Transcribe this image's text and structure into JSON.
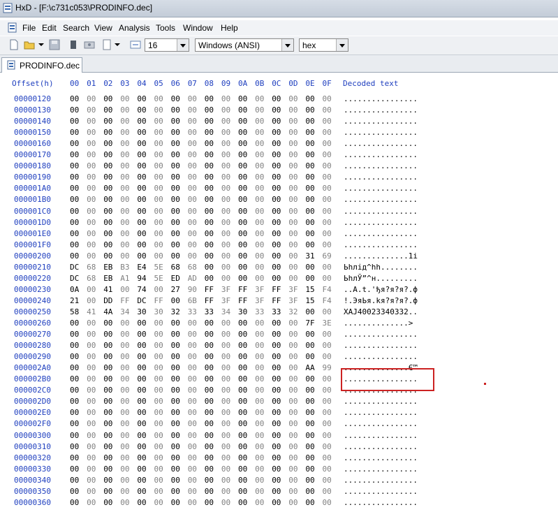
{
  "window": {
    "title": "HxD - [F:\\c731c053\\PRODINFO.dec]"
  },
  "menu": [
    "File",
    "Edit",
    "Search",
    "View",
    "Analysis",
    "Tools",
    "Window",
    "Help"
  ],
  "toolbar": {
    "bytes_per_row": "16",
    "charset": "Windows (ANSI)",
    "offset_base": "hex"
  },
  "tab": {
    "label": "PRODINFO.dec"
  },
  "header": {
    "offset": "Offset(h)",
    "columns": [
      "00",
      "01",
      "02",
      "03",
      "04",
      "05",
      "06",
      "07",
      "08",
      "09",
      "0A",
      "0B",
      "0C",
      "0D",
      "0E",
      "0F"
    ],
    "decoded": "Decoded text"
  },
  "rows": [
    {
      "offset": "00000120",
      "bytes": [
        "00",
        "00",
        "00",
        "00",
        "00",
        "00",
        "00",
        "00",
        "00",
        "00",
        "00",
        "00",
        "00",
        "00",
        "00",
        "00"
      ],
      "text": "................"
    },
    {
      "offset": "00000130",
      "bytes": [
        "00",
        "00",
        "00",
        "00",
        "00",
        "00",
        "00",
        "00",
        "00",
        "00",
        "00",
        "00",
        "00",
        "00",
        "00",
        "00"
      ],
      "text": "................"
    },
    {
      "offset": "00000140",
      "bytes": [
        "00",
        "00",
        "00",
        "00",
        "00",
        "00",
        "00",
        "00",
        "00",
        "00",
        "00",
        "00",
        "00",
        "00",
        "00",
        "00"
      ],
      "text": "................"
    },
    {
      "offset": "00000150",
      "bytes": [
        "00",
        "00",
        "00",
        "00",
        "00",
        "00",
        "00",
        "00",
        "00",
        "00",
        "00",
        "00",
        "00",
        "00",
        "00",
        "00"
      ],
      "text": "................"
    },
    {
      "offset": "00000160",
      "bytes": [
        "00",
        "00",
        "00",
        "00",
        "00",
        "00",
        "00",
        "00",
        "00",
        "00",
        "00",
        "00",
        "00",
        "00",
        "00",
        "00"
      ],
      "text": "................"
    },
    {
      "offset": "00000170",
      "bytes": [
        "00",
        "00",
        "00",
        "00",
        "00",
        "00",
        "00",
        "00",
        "00",
        "00",
        "00",
        "00",
        "00",
        "00",
        "00",
        "00"
      ],
      "text": "................"
    },
    {
      "offset": "00000180",
      "bytes": [
        "00",
        "00",
        "00",
        "00",
        "00",
        "00",
        "00",
        "00",
        "00",
        "00",
        "00",
        "00",
        "00",
        "00",
        "00",
        "00"
      ],
      "text": "................"
    },
    {
      "offset": "00000190",
      "bytes": [
        "00",
        "00",
        "00",
        "00",
        "00",
        "00",
        "00",
        "00",
        "00",
        "00",
        "00",
        "00",
        "00",
        "00",
        "00",
        "00"
      ],
      "text": "................"
    },
    {
      "offset": "000001A0",
      "bytes": [
        "00",
        "00",
        "00",
        "00",
        "00",
        "00",
        "00",
        "00",
        "00",
        "00",
        "00",
        "00",
        "00",
        "00",
        "00",
        "00"
      ],
      "text": "................"
    },
    {
      "offset": "000001B0",
      "bytes": [
        "00",
        "00",
        "00",
        "00",
        "00",
        "00",
        "00",
        "00",
        "00",
        "00",
        "00",
        "00",
        "00",
        "00",
        "00",
        "00"
      ],
      "text": "................"
    },
    {
      "offset": "000001C0",
      "bytes": [
        "00",
        "00",
        "00",
        "00",
        "00",
        "00",
        "00",
        "00",
        "00",
        "00",
        "00",
        "00",
        "00",
        "00",
        "00",
        "00"
      ],
      "text": "................"
    },
    {
      "offset": "000001D0",
      "bytes": [
        "00",
        "00",
        "00",
        "00",
        "00",
        "00",
        "00",
        "00",
        "00",
        "00",
        "00",
        "00",
        "00",
        "00",
        "00",
        "00"
      ],
      "text": "................"
    },
    {
      "offset": "000001E0",
      "bytes": [
        "00",
        "00",
        "00",
        "00",
        "00",
        "00",
        "00",
        "00",
        "00",
        "00",
        "00",
        "00",
        "00",
        "00",
        "00",
        "00"
      ],
      "text": "................"
    },
    {
      "offset": "000001F0",
      "bytes": [
        "00",
        "00",
        "00",
        "00",
        "00",
        "00",
        "00",
        "00",
        "00",
        "00",
        "00",
        "00",
        "00",
        "00",
        "00",
        "00"
      ],
      "text": "................"
    },
    {
      "offset": "00000200",
      "bytes": [
        "00",
        "00",
        "00",
        "00",
        "00",
        "00",
        "00",
        "00",
        "00",
        "00",
        "00",
        "00",
        "00",
        "00",
        "31",
        "69"
      ],
      "text": "..............1i"
    },
    {
      "offset": "00000210",
      "bytes": [
        "DC",
        "68",
        "EB",
        "B3",
        "E4",
        "5E",
        "68",
        "68",
        "00",
        "00",
        "00",
        "00",
        "00",
        "00",
        "00",
        "00"
      ],
      "text": "Ьhлід^hh........"
    },
    {
      "offset": "00000220",
      "bytes": [
        "DC",
        "68",
        "EB",
        "A1",
        "94",
        "5E",
        "ED",
        "AD",
        "00",
        "00",
        "00",
        "00",
        "00",
        "00",
        "00",
        "00"
      ],
      "text": "ЬhлЎ”^н........."
    },
    {
      "offset": "00000230",
      "bytes": [
        "0A",
        "00",
        "41",
        "00",
        "74",
        "00",
        "27",
        "90",
        "FF",
        "3F",
        "FF",
        "3F",
        "FF",
        "3F",
        "15",
        "F4"
      ],
      "text": "..A.t.'ђя?я?я?.ф"
    },
    {
      "offset": "00000240",
      "bytes": [
        "21",
        "00",
        "DD",
        "FF",
        "DC",
        "FF",
        "00",
        "6B",
        "FF",
        "3F",
        "FF",
        "3F",
        "FF",
        "3F",
        "15",
        "F4"
      ],
      "text": "!.ЭяЬя.kя?я?я?.ф"
    },
    {
      "offset": "00000250",
      "bytes": [
        "58",
        "41",
        "4A",
        "34",
        "30",
        "30",
        "32",
        "33",
        "33",
        "34",
        "30",
        "33",
        "33",
        "32",
        "00",
        "00"
      ],
      "text": "XAJ40023340332.."
    },
    {
      "offset": "00000260",
      "bytes": [
        "00",
        "00",
        "00",
        "00",
        "00",
        "00",
        "00",
        "00",
        "00",
        "00",
        "00",
        "00",
        "00",
        "00",
        "7F",
        "3E"
      ],
      "text": "..............>"
    },
    {
      "offset": "00000270",
      "bytes": [
        "00",
        "00",
        "00",
        "00",
        "00",
        "00",
        "00",
        "00",
        "00",
        "00",
        "00",
        "00",
        "00",
        "00",
        "00",
        "00"
      ],
      "text": "................"
    },
    {
      "offset": "00000280",
      "bytes": [
        "00",
        "00",
        "00",
        "00",
        "00",
        "00",
        "00",
        "00",
        "00",
        "00",
        "00",
        "00",
        "00",
        "00",
        "00",
        "00"
      ],
      "text": "................"
    },
    {
      "offset": "00000290",
      "bytes": [
        "00",
        "00",
        "00",
        "00",
        "00",
        "00",
        "00",
        "00",
        "00",
        "00",
        "00",
        "00",
        "00",
        "00",
        "00",
        "00"
      ],
      "text": "................"
    },
    {
      "offset": "000002A0",
      "bytes": [
        "00",
        "00",
        "00",
        "00",
        "00",
        "00",
        "00",
        "00",
        "00",
        "00",
        "00",
        "00",
        "00",
        "00",
        "AA",
        "99"
      ],
      "text": "..............Є™"
    },
    {
      "offset": "000002B0",
      "bytes": [
        "00",
        "00",
        "00",
        "00",
        "00",
        "00",
        "00",
        "00",
        "00",
        "00",
        "00",
        "00",
        "00",
        "00",
        "00",
        "00"
      ],
      "text": "................"
    },
    {
      "offset": "000002C0",
      "bytes": [
        "00",
        "00",
        "00",
        "00",
        "00",
        "00",
        "00",
        "00",
        "00",
        "00",
        "00",
        "00",
        "00",
        "00",
        "00",
        "00"
      ],
      "text": "................"
    },
    {
      "offset": "000002D0",
      "bytes": [
        "00",
        "00",
        "00",
        "00",
        "00",
        "00",
        "00",
        "00",
        "00",
        "00",
        "00",
        "00",
        "00",
        "00",
        "00",
        "00"
      ],
      "text": "................"
    },
    {
      "offset": "000002E0",
      "bytes": [
        "00",
        "00",
        "00",
        "00",
        "00",
        "00",
        "00",
        "00",
        "00",
        "00",
        "00",
        "00",
        "00",
        "00",
        "00",
        "00"
      ],
      "text": "................"
    },
    {
      "offset": "000002F0",
      "bytes": [
        "00",
        "00",
        "00",
        "00",
        "00",
        "00",
        "00",
        "00",
        "00",
        "00",
        "00",
        "00",
        "00",
        "00",
        "00",
        "00"
      ],
      "text": "................"
    },
    {
      "offset": "00000300",
      "bytes": [
        "00",
        "00",
        "00",
        "00",
        "00",
        "00",
        "00",
        "00",
        "00",
        "00",
        "00",
        "00",
        "00",
        "00",
        "00",
        "00"
      ],
      "text": "................"
    },
    {
      "offset": "00000310",
      "bytes": [
        "00",
        "00",
        "00",
        "00",
        "00",
        "00",
        "00",
        "00",
        "00",
        "00",
        "00",
        "00",
        "00",
        "00",
        "00",
        "00"
      ],
      "text": "................"
    },
    {
      "offset": "00000320",
      "bytes": [
        "00",
        "00",
        "00",
        "00",
        "00",
        "00",
        "00",
        "00",
        "00",
        "00",
        "00",
        "00",
        "00",
        "00",
        "00",
        "00"
      ],
      "text": "................"
    },
    {
      "offset": "00000330",
      "bytes": [
        "00",
        "00",
        "00",
        "00",
        "00",
        "00",
        "00",
        "00",
        "00",
        "00",
        "00",
        "00",
        "00",
        "00",
        "00",
        "00"
      ],
      "text": "................"
    },
    {
      "offset": "00000340",
      "bytes": [
        "00",
        "00",
        "00",
        "00",
        "00",
        "00",
        "00",
        "00",
        "00",
        "00",
        "00",
        "00",
        "00",
        "00",
        "00",
        "00"
      ],
      "text": "................"
    },
    {
      "offset": "00000350",
      "bytes": [
        "00",
        "00",
        "00",
        "00",
        "00",
        "00",
        "00",
        "00",
        "00",
        "00",
        "00",
        "00",
        "00",
        "00",
        "00",
        "00"
      ],
      "text": "................"
    },
    {
      "offset": "00000360",
      "bytes": [
        "00",
        "00",
        "00",
        "00",
        "00",
        "00",
        "00",
        "00",
        "00",
        "00",
        "00",
        "00",
        "00",
        "00",
        "00",
        "00"
      ],
      "text": "................"
    }
  ],
  "colors": {
    "offset_blue": "#1f3fbf",
    "highlight_red": "#cc2222",
    "alt_gray": "#808080"
  }
}
